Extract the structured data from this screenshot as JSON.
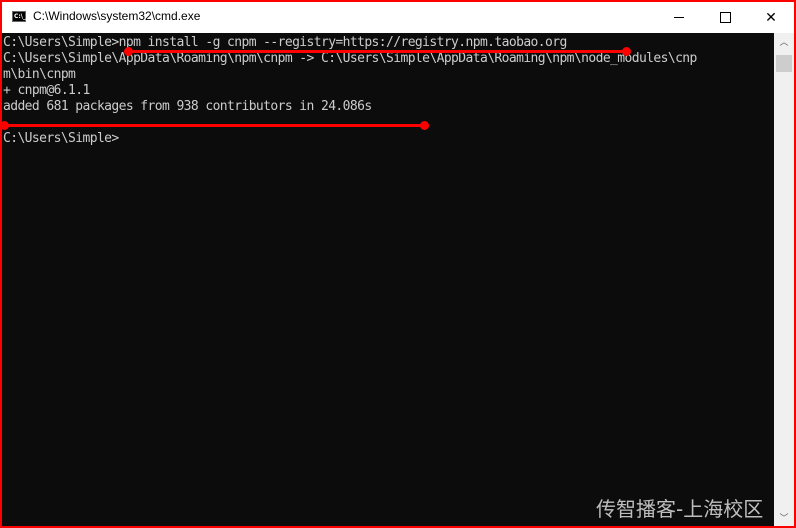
{
  "window": {
    "title": "C:\\Windows\\system32\\cmd.exe",
    "app_icon": "cmd-icon",
    "app_icon_label": "C:\\_",
    "controls": {
      "minimize": "minimize-icon",
      "maximize": "maximize-icon",
      "close_glyph": "✕"
    }
  },
  "console": {
    "lines": [
      "C:\\Users\\Simple>npm install -g cnpm --registry=https://registry.npm.taobao.org",
      "C:\\Users\\Simple\\AppData\\Roaming\\npm\\cnpm -> C:\\Users\\Simple\\AppData\\Roaming\\npm\\node_modules\\cnp",
      "m\\bin\\cnpm",
      "+ cnpm@6.1.1",
      "added 681 packages from 938 contributors in 24.086s",
      "",
      "C:\\Users\\Simple>"
    ]
  },
  "scrollbar": {
    "up_glyph": "︿",
    "down_glyph": "﹀"
  },
  "annotations": {
    "color": "#ff0000",
    "underline_command": "red-underline",
    "separator_line": "red-separator"
  },
  "watermark": {
    "text": "传智播客-上海校区"
  }
}
